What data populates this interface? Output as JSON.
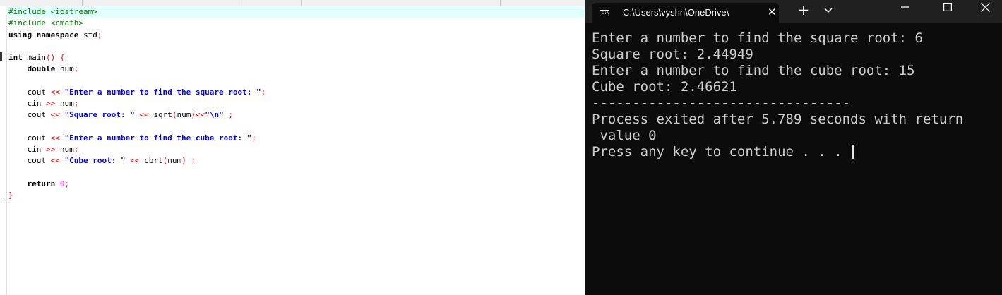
{
  "editor": {
    "lines": [
      [
        {
          "t": "#include <iostream>",
          "c": "pp"
        }
      ],
      [
        {
          "t": "#include <cmath>",
          "c": "pp"
        }
      ],
      [
        {
          "t": "using namespace ",
          "c": "kw"
        },
        {
          "t": "std",
          "c": "plain"
        },
        {
          "t": ";",
          "c": "op"
        }
      ],
      [],
      [
        {
          "t": "int ",
          "c": "kw"
        },
        {
          "t": "main",
          "c": "plain"
        },
        {
          "t": "() {",
          "c": "op"
        }
      ],
      [
        {
          "t": "    double ",
          "c": "kw"
        },
        {
          "t": "num",
          "c": "plain"
        },
        {
          "t": ";",
          "c": "op"
        }
      ],
      [],
      [
        {
          "t": "    cout ",
          "c": "plain"
        },
        {
          "t": "<< ",
          "c": "op"
        },
        {
          "t": "\"Enter a number to find the square root: \"",
          "c": "str"
        },
        {
          "t": ";",
          "c": "op"
        }
      ],
      [
        {
          "t": "    cin ",
          "c": "plain"
        },
        {
          "t": ">> ",
          "c": "op"
        },
        {
          "t": "num",
          "c": "plain"
        },
        {
          "t": ";",
          "c": "op"
        }
      ],
      [
        {
          "t": "    cout ",
          "c": "plain"
        },
        {
          "t": "<< ",
          "c": "op"
        },
        {
          "t": "\"Square root: \"",
          "c": "str"
        },
        {
          "t": " << ",
          "c": "op"
        },
        {
          "t": "sqrt",
          "c": "plain"
        },
        {
          "t": "(",
          "c": "op"
        },
        {
          "t": "num",
          "c": "plain"
        },
        {
          "t": ")<<",
          "c": "op"
        },
        {
          "t": "\"\\n\"",
          "c": "str"
        },
        {
          "t": " ;",
          "c": "op"
        }
      ],
      [],
      [
        {
          "t": "    cout ",
          "c": "plain"
        },
        {
          "t": "<< ",
          "c": "op"
        },
        {
          "t": "\"Enter a number to find the cube root: \"",
          "c": "str"
        },
        {
          "t": ";",
          "c": "op"
        }
      ],
      [
        {
          "t": "    cin ",
          "c": "plain"
        },
        {
          "t": ">> ",
          "c": "op"
        },
        {
          "t": "num",
          "c": "plain"
        },
        {
          "t": ";",
          "c": "op"
        }
      ],
      [
        {
          "t": "    cout ",
          "c": "plain"
        },
        {
          "t": "<< ",
          "c": "op"
        },
        {
          "t": "\"Cube root: \"",
          "c": "str"
        },
        {
          "t": " << ",
          "c": "op"
        },
        {
          "t": "cbrt",
          "c": "plain"
        },
        {
          "t": "(",
          "c": "op"
        },
        {
          "t": "num",
          "c": "plain"
        },
        {
          "t": ") ;",
          "c": "op"
        }
      ],
      [],
      [
        {
          "t": "    return ",
          "c": "kw"
        },
        {
          "t": "0",
          "c": "num"
        },
        {
          "t": ";",
          "c": "op"
        }
      ],
      [
        {
          "t": "}",
          "c": "op"
        }
      ]
    ],
    "highlighted_line": 0
  },
  "terminal": {
    "tab_title": "C:\\Users\\vyshn\\OneDrive\\",
    "tab_icon_glyph": "C:\\",
    "close_tab_glyph": "✕",
    "new_tab_glyph": "+",
    "output": [
      "Enter a number to find the square root: 6",
      "Square root: 2.44949",
      "Enter a number to find the cube root: 15",
      "Cube root: 2.46621",
      "--------------------------------",
      "Process exited after 5.789 seconds with return",
      " value 0",
      "Press any key to continue . . . "
    ]
  },
  "colors": {
    "terminal_bg": "#0c0c0c",
    "titlebar_bg": "#202020",
    "terminal_text": "#cccccc",
    "preprocessor": "#008000",
    "string": "#0000ff",
    "operator": "#ff0000",
    "number": "#ff00ff",
    "current_line": "#e0ffff"
  },
  "icons": {
    "tab_icon": "terminal-icon",
    "close": "close-icon",
    "new_tab": "plus-icon",
    "dropdown": "chevron-down-icon",
    "minimize": "minimize-icon",
    "maximize": "maximize-icon",
    "window_close": "close-icon"
  }
}
